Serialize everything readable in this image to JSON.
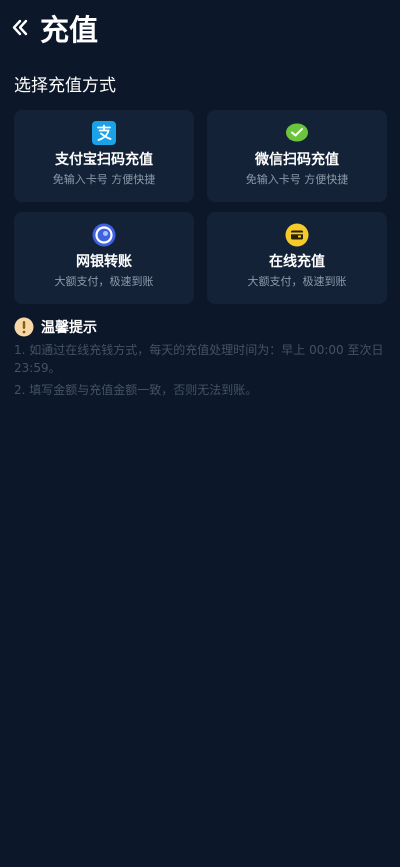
{
  "header": {
    "back_icon": "chevron-left-icon",
    "title": "充值"
  },
  "methods": {
    "section_title": "选择充值方式",
    "items": [
      {
        "title": "支付宝扫码充值",
        "subtitle": "免输入卡号 方便快捷",
        "icon": "alipay-icon",
        "color": "#1aa1e6"
      },
      {
        "title": "微信扫码充值",
        "subtitle": "免输入卡号 方便快捷",
        "icon": "wechat-icon",
        "color": "#6cc43c"
      },
      {
        "title": "网银转账",
        "subtitle": "大额支付，极速到账",
        "icon": "bank-transfer-icon",
        "color": "#3f62e0"
      },
      {
        "title": "在线充值",
        "subtitle": "大额支付，极速到账",
        "icon": "wallet-icon",
        "color": "#f4cb2b"
      }
    ]
  },
  "tips": {
    "title": "温馨提示",
    "icon": "warning-icon",
    "items": [
      "1. 如通过在线充钱方式，每天的充值处理时间为：早上 00:00 至次日 23:59。",
      "2. 填写金额与充值金额一致，否则无法到账。"
    ]
  },
  "colors": {
    "background": "#0c1729",
    "card": "#142238",
    "subtext": "#8e9aab",
    "tip_text": "#445267"
  }
}
